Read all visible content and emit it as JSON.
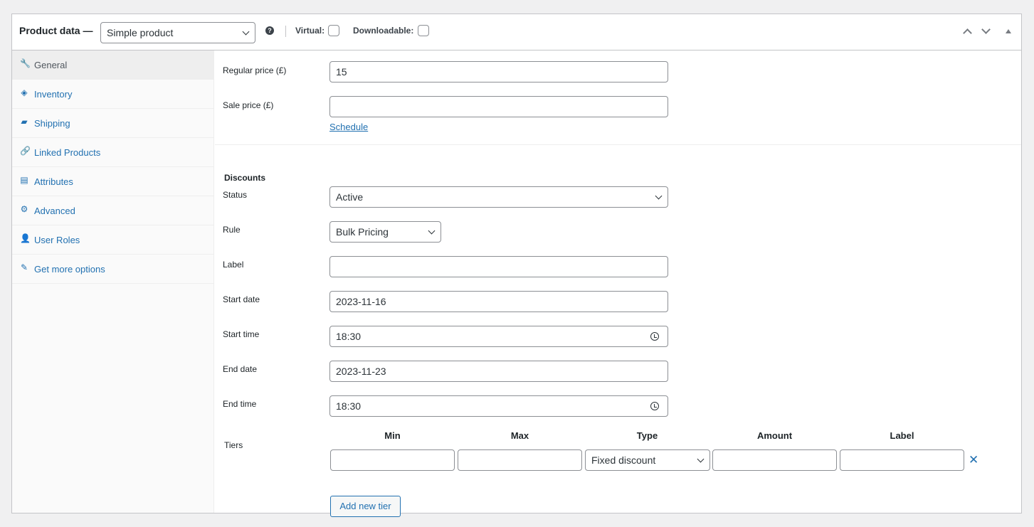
{
  "header": {
    "title": "Product data —",
    "product_type": "Simple product",
    "help_glyph": "?",
    "virtual_label": "Virtual:",
    "downloadable_label": "Downloadable:"
  },
  "sidebar": {
    "tabs": [
      {
        "label": "General",
        "icon": "wrench-icon",
        "glyph": "🔧",
        "active": true
      },
      {
        "label": "Inventory",
        "icon": "tag-icon",
        "glyph": "◈"
      },
      {
        "label": "Shipping",
        "icon": "truck-icon",
        "glyph": "▰"
      },
      {
        "label": "Linked Products",
        "icon": "link-icon",
        "glyph": "🔗"
      },
      {
        "label": "Attributes",
        "icon": "list-icon",
        "glyph": "▤"
      },
      {
        "label": "Advanced",
        "icon": "gear-icon",
        "glyph": "⚙"
      },
      {
        "label": "User Roles",
        "icon": "user-icon",
        "glyph": "👤"
      },
      {
        "label": "Get more options",
        "icon": "plugin-icon",
        "glyph": "✎"
      }
    ]
  },
  "pricing": {
    "regular_price_label": "Regular price (£)",
    "regular_price_value": "15",
    "sale_price_label": "Sale price (£)",
    "sale_price_value": "",
    "schedule_link": "Schedule"
  },
  "discounts": {
    "section_title": "Discounts",
    "status_label": "Status",
    "status_value": "Active",
    "rule_label": "Rule",
    "rule_value": "Bulk Pricing",
    "label_label": "Label",
    "label_value": "",
    "start_date_label": "Start date",
    "start_date_value": "2023-11-16",
    "start_time_label": "Start time",
    "start_time_value": "18:30",
    "end_date_label": "End date",
    "end_date_value": "2023-11-23",
    "end_time_label": "End time",
    "end_time_value": "18:30",
    "tiers_label": "Tiers",
    "tier_columns": [
      "Min",
      "Max",
      "Type",
      "Amount",
      "Label"
    ],
    "tier_row": {
      "min": "",
      "max": "",
      "type": "Fixed discount",
      "amount": "",
      "label": ""
    },
    "remove_glyph": "✕",
    "add_tier_button": "Add new tier"
  }
}
